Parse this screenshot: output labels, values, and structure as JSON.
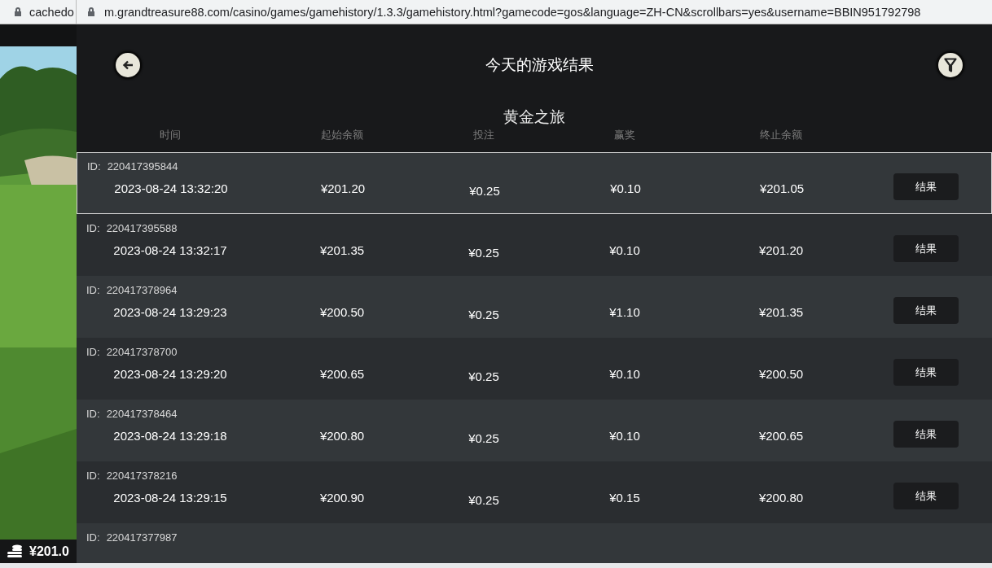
{
  "browser": {
    "background_tab_url": "cachedo",
    "url": "m.grandtreasure88.com/casino/games/gamehistory/1.3.3/gamehistory.html?gamecode=gos&language=ZH-CN&scrollbars=yes&username=BBIN951792798"
  },
  "background_game": {
    "balance": "¥201.0"
  },
  "header": {
    "title": "今天的游戏结果"
  },
  "game_name": "黄金之旅",
  "columns": [
    "时间",
    "起始余额",
    "投注",
    "赢奖",
    "终止余额"
  ],
  "rows": [
    {
      "id_label": "ID:",
      "id": "220417395844",
      "time": "2023-08-24 13:32:20",
      "start": "¥201.20",
      "bet": "¥0.25",
      "win": "¥0.10",
      "end": "¥201.05",
      "button": "结果",
      "selected": true
    },
    {
      "id_label": "ID:",
      "id": "220417395588",
      "time": "2023-08-24 13:32:17",
      "start": "¥201.35",
      "bet": "¥0.25",
      "win": "¥0.10",
      "end": "¥201.20",
      "button": "结果",
      "selected": false
    },
    {
      "id_label": "ID:",
      "id": "220417378964",
      "time": "2023-08-24 13:29:23",
      "start": "¥200.50",
      "bet": "¥0.25",
      "win": "¥1.10",
      "end": "¥201.35",
      "button": "结果",
      "selected": false
    },
    {
      "id_label": "ID:",
      "id": "220417378700",
      "time": "2023-08-24 13:29:20",
      "start": "¥200.65",
      "bet": "¥0.25",
      "win": "¥0.10",
      "end": "¥200.50",
      "button": "结果",
      "selected": false
    },
    {
      "id_label": "ID:",
      "id": "220417378464",
      "time": "2023-08-24 13:29:18",
      "start": "¥200.80",
      "bet": "¥0.25",
      "win": "¥0.10",
      "end": "¥200.65",
      "button": "结果",
      "selected": false
    },
    {
      "id_label": "ID:",
      "id": "220417378216",
      "time": "2023-08-24 13:29:15",
      "start": "¥200.90",
      "bet": "¥0.25",
      "win": "¥0.15",
      "end": "¥200.80",
      "button": "结果",
      "selected": false
    },
    {
      "id_label": "ID:",
      "id": "220417377987",
      "selected": false
    }
  ]
}
